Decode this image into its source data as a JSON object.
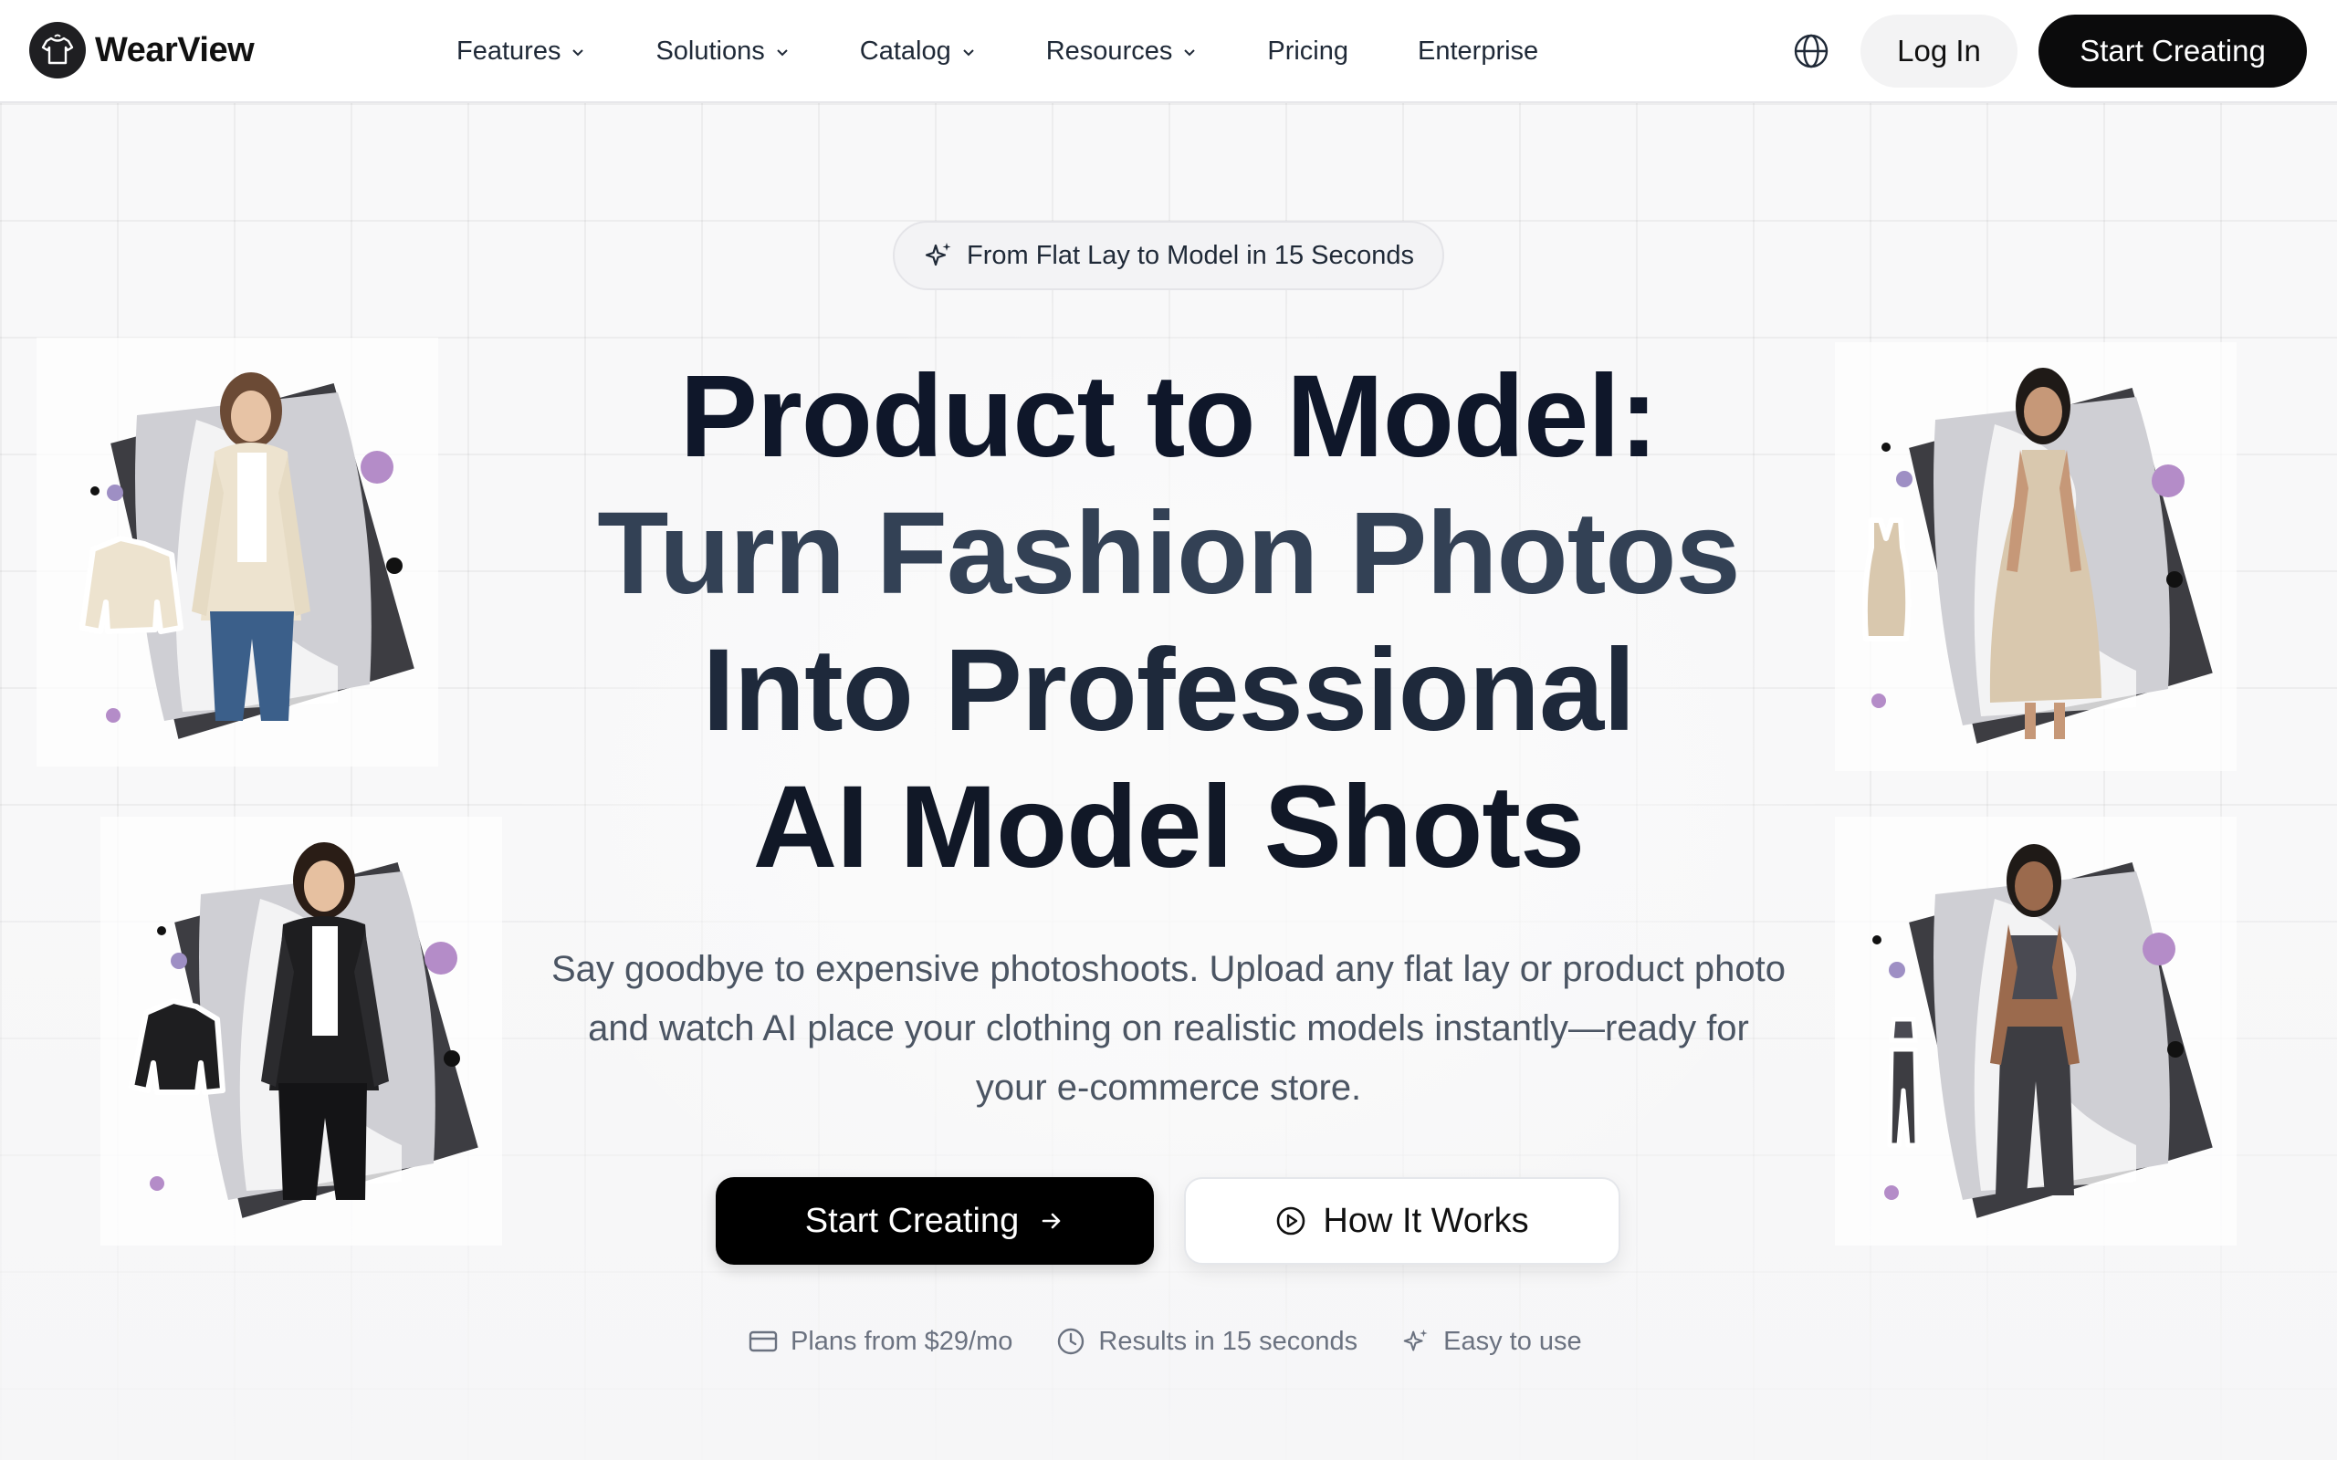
{
  "brand": {
    "name": "WearView"
  },
  "nav": {
    "items": [
      {
        "label": "Features",
        "has_dropdown": true
      },
      {
        "label": "Solutions",
        "has_dropdown": true
      },
      {
        "label": "Catalog",
        "has_dropdown": true
      },
      {
        "label": "Resources",
        "has_dropdown": true
      },
      {
        "label": "Pricing",
        "has_dropdown": false
      },
      {
        "label": "Enterprise",
        "has_dropdown": false
      }
    ],
    "login_label": "Log In",
    "start_label": "Start Creating",
    "language_icon": "globe-icon"
  },
  "hero": {
    "badge": "From Flat Lay to Model in 15 Seconds",
    "headline": [
      "Product to Model:",
      "Turn Fashion Photos",
      "Into Professional",
      "AI Model Shots"
    ],
    "subtitle": "Say goodbye to expensive photoshoots. Upload any flat lay or product photo and watch AI place your clothing on realistic models instantly—ready for your e-commerce store.",
    "cta_primary": "Start Creating",
    "cta_secondary": "How It Works",
    "features": [
      {
        "icon": "credit-card-icon",
        "label": "Plans from $29/mo"
      },
      {
        "icon": "clock-icon",
        "label": "Results in 15 seconds"
      },
      {
        "icon": "sparkles-icon",
        "label": "Easy to use"
      }
    ]
  },
  "showcase": [
    {
      "garment": "cream cardigan",
      "colors": {
        "garment": "#ede3cf",
        "pants": "#3b5f8a"
      }
    },
    {
      "garment": "black leather jacket",
      "colors": {
        "garment": "#1e1e20",
        "pants": "#141416"
      }
    },
    {
      "garment": "champagne slip dress",
      "colors": {
        "garment": "#d9c8ae",
        "pants": "#d9c8ae"
      }
    },
    {
      "garment": "charcoal activewear set",
      "colors": {
        "garment": "#4a4a52",
        "pants": "#3d3d44"
      }
    }
  ],
  "colors": {
    "accent_purple": "#b48cc8",
    "dark": "#0b0b0c",
    "headline": "#0f172a"
  }
}
